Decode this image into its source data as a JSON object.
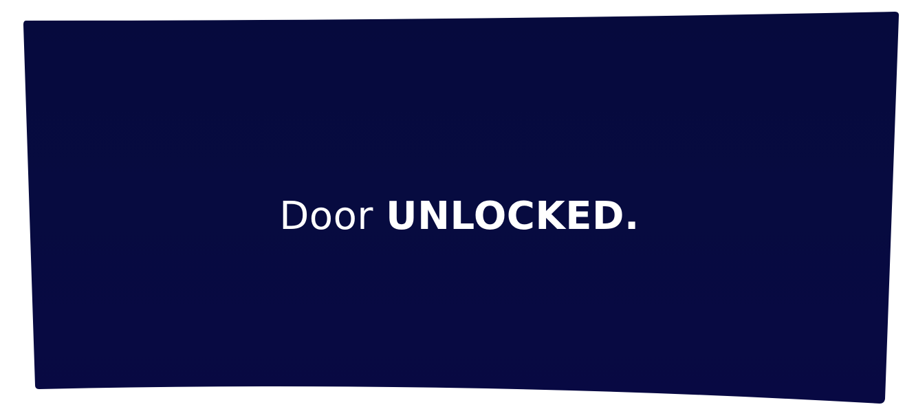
{
  "message": {
    "prefix": "Door",
    "status": "UNLOCKED."
  },
  "colors": {
    "panel": "#070b3f",
    "panel_dark": "#050a3b",
    "text": "#ffffff",
    "background": "#ffffff"
  }
}
